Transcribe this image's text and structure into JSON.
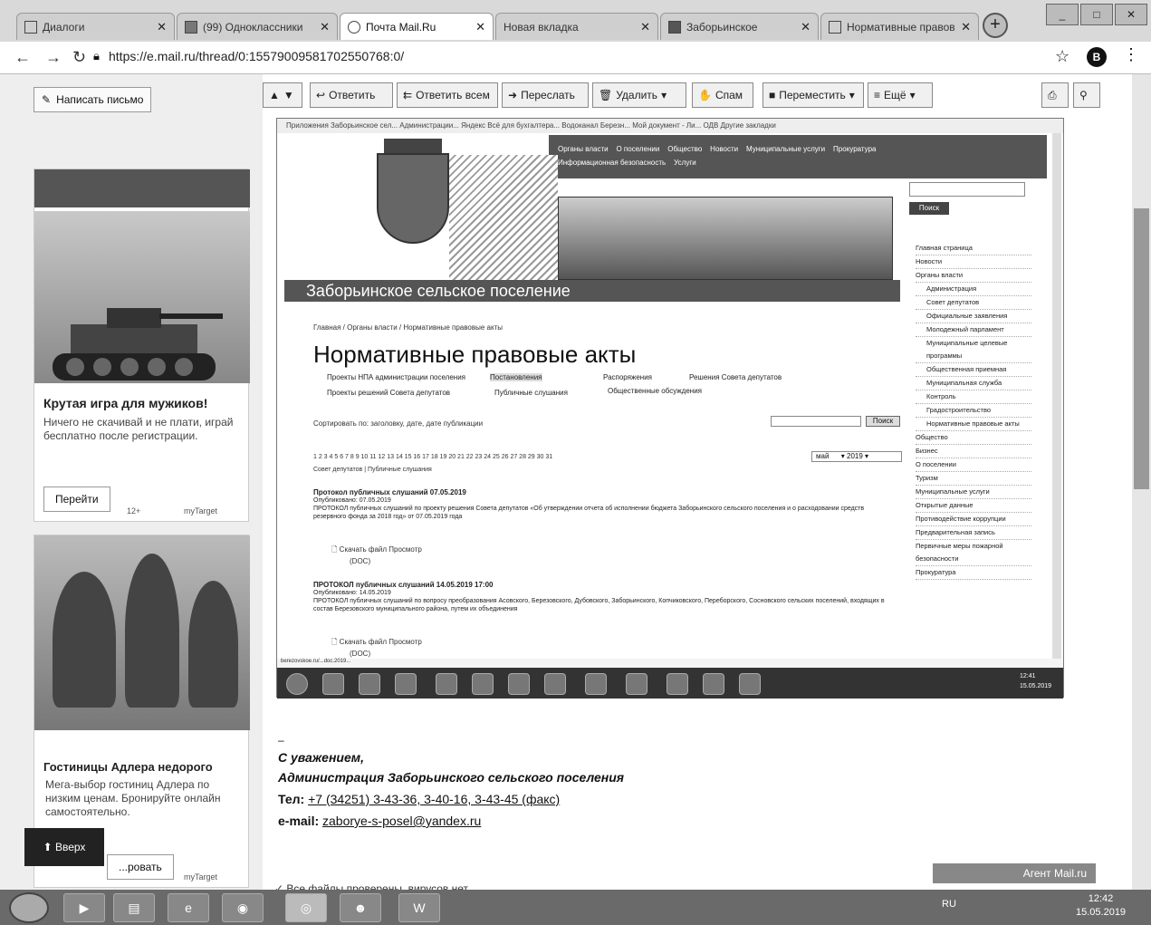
{
  "browser": {
    "tabs": [
      {
        "label": "Диалоги"
      },
      {
        "label": "(99) Одноклассники"
      },
      {
        "label": "Почта Mail.Ru",
        "active": true
      },
      {
        "label": "Новая вкладка"
      },
      {
        "label": "Заборьинское"
      },
      {
        "label": "Нормативные правов"
      }
    ],
    "url": "https://e.mail.ru/thread/0:15579009581702550768:0/",
    "profile_letter": "В",
    "window_buttons": [
      "_",
      "□",
      "✕"
    ]
  },
  "mail": {
    "write_button": "Написать письмо",
    "toolbar": {
      "reply": "Ответить",
      "reply_all": "Ответить всем",
      "forward": "Переслать",
      "delete": "Удалить",
      "spam": "Спам",
      "move": "Переместить",
      "more": "Ещё"
    },
    "up_button": "Вверх"
  },
  "ads": [
    {
      "title": "Крутая игра для мужиков!",
      "text": "Ничего не скачивай и не плати, играй бесплатно после регистрации.",
      "button": "Перейти",
      "age": "12+",
      "brand": "myTarget"
    },
    {
      "title": "Гостиницы Адлера недорого",
      "text": "Мега-выбор гостиниц Адлера по низким ценам. Бронируйте онлайн самостоятельно.",
      "button": "...ровать",
      "brand": "myTarget"
    }
  ],
  "embedded": {
    "bookmarks": "Приложения   Заборьинское сел...   Администрации...   Яндекс   Всё для бухгалтера...   Водоканал Березн...   Мой документ - Ли...   ОДВ        Другие закладки",
    "site_nav": [
      "Органы власти",
      "О поселении",
      "Общество",
      "Новости",
      "Муниципальные услуги",
      "Прокуратура",
      "Информационная безопасность",
      "Услуги"
    ],
    "site_name": "Заборьинское сельское поселение",
    "breadcrumb": "Главная / Органы власти / Нормативные правовые акты",
    "page_title": "Нормативные правовые акты",
    "subnav": [
      "Проекты НПА администрации поселения",
      "Постановления",
      "Распоряжения",
      "Решения Совета депутатов",
      "Проекты решений Совета депутатов",
      "Публичные слушания",
      "Общественные обсуждения"
    ],
    "sort_line": "Сортировать по: заголовку, дате, дате публикации",
    "search_btn": "Поиск",
    "pager": "1 2 3 4 5 6 7 8 9 10 11 12 13 14 15 16 17 18 19 20 21 22 23 24 25 26 27 28 29 30 31",
    "month": "май",
    "year": "2019",
    "section_line": "Совет депутатов | Публичные слушания",
    "docs": [
      {
        "title": "Протокол публичных слушаний 07.05.2019",
        "date": "Опубликовано: 07.05.2019",
        "text": "ПРОТОКОЛ публичных слушаний по проекту решения Совета депутатов «Об утверждении отчета об исполнении бюджета Заборьинского сельского поселения и о расходовании средств резервного фонда за 2018 год» от 07.05.2019 года",
        "links": "Скачать файл   Просмотр",
        "size": "(DOC)"
      },
      {
        "title": "ПРОТОКОЛ публичных слушаний 14.05.2019 17:00",
        "date": "Опубликовано: 14.05.2019",
        "text": "ПРОТОКОЛ публичных слушаний по вопросу преобразования Асовского, Березовского, Дубовского, Заборьинского, Копчиковского, Переборского, Сосновского сельских поселений, входящих в состав Березовского муниципального района, путем их объединения",
        "links": "Скачать файл   Просмотр",
        "size": "(DOC)"
      }
    ],
    "side_search_btn": "Поиск",
    "side_menu": [
      "Главная страница",
      "Новости",
      "Органы власти",
      "Администрация",
      "Совет депутатов",
      "Официальные заявления",
      "Молодежный парламент",
      "Муниципальные целевые программы",
      "Общественная приемная",
      "Муниципальная служба",
      "Контроль",
      "Градостроительство",
      "Нормативные правовые акты",
      "Общество",
      "Бизнес",
      "О поселении",
      "Туризм",
      "Муниципальные услуги",
      "Открытые данные",
      "Противодействие коррупции",
      "Предварительная запись",
      "Первичные меры пожарной безопасности",
      "Прокуратура"
    ],
    "side_menu_indent": [
      false,
      false,
      false,
      true,
      true,
      true,
      true,
      true,
      true,
      true,
      true,
      true,
      true,
      false,
      false,
      false,
      false,
      false,
      false,
      false,
      false,
      false,
      false
    ],
    "status_url": "berezovskoe.ru/...doc.2019...",
    "inner_clock": "12:41\n15.05.2019"
  },
  "signature": {
    "regards": "С уважением,",
    "org": "Администрация Заборьинского сельского поселения",
    "phone_label": "Тел:",
    "phone_value": "+7 (34251) 3-43-36, 3-40-16, 3-43-45 (факс)",
    "email_label": "e-mail:",
    "email_value": "zaborye-s-posel@yandex.ru",
    "dash": "–"
  },
  "files_line": "✓ Все файлы проверены, вирусов нет",
  "agent": "Агент Mail.ru",
  "taskbar": {
    "lang": "RU",
    "time": "12:42",
    "date": "15.05.2019"
  }
}
